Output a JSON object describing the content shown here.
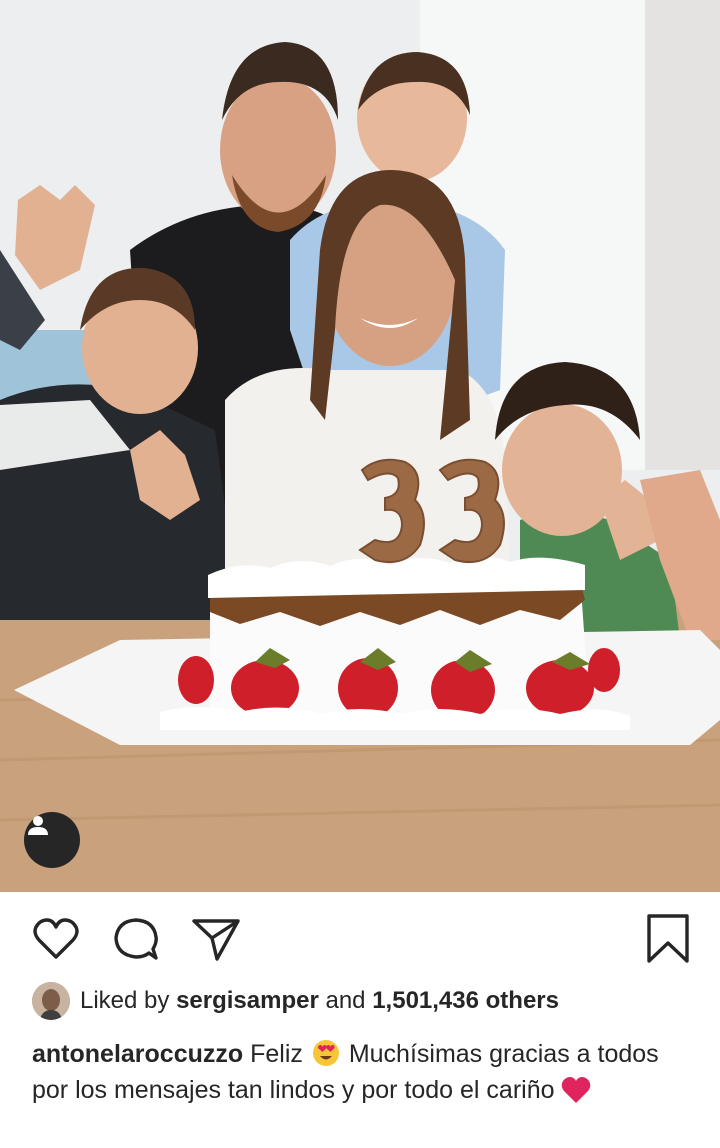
{
  "post": {
    "photo": {
      "description_icon": "tagged-people-icon",
      "cake_candle_number": "33"
    },
    "actions": {
      "like_icon": "heart-outline-icon",
      "comment_icon": "comment-bubble-icon",
      "share_icon": "paper-plane-icon",
      "save_icon": "bookmark-icon"
    },
    "likes": {
      "prefix": "Liked by",
      "user": "sergisamper",
      "middle": "and",
      "count": "1,501,436 others"
    },
    "caption": {
      "username": "antonelaroccuzzo",
      "text_part1": "Feliz",
      "emoji1": "heart-eyes-emoji",
      "text_part2": "Muchísimas gracias a todos por los mensajes tan lindos y por todo el cariño",
      "emoji2": "red-heart-emoji"
    }
  },
  "colors": {
    "text": "#262626",
    "heart_red": "#e0245e",
    "table_wood": "#c9a27d",
    "wall": "#eef0f1"
  }
}
